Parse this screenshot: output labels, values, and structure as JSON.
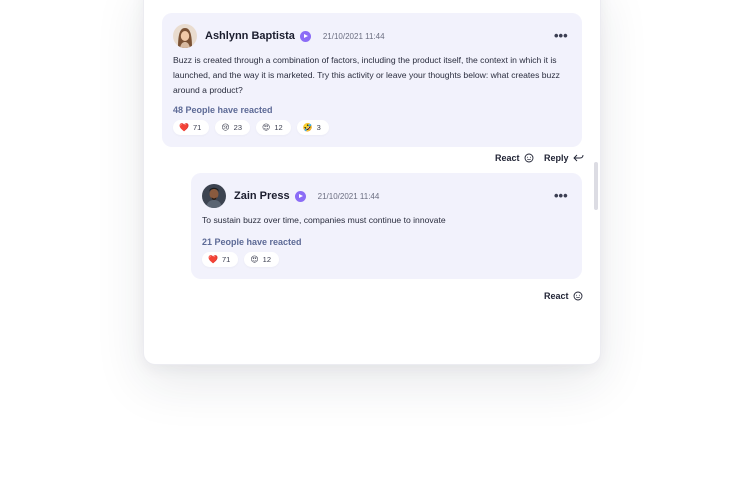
{
  "comments": [
    {
      "author": "Ashlynn Baptista",
      "timestamp": "21/10/2021 11:44",
      "text": "Buzz is created through a combination of factors, including the product itself, the context in which it is launched, and the way it is marketed. Try this activity or leave your thoughts below: what creates buzz around a product?",
      "reacted_label": "48 People have reacted",
      "reactions": [
        {
          "emoji": "❤️",
          "icon": "heart-icon",
          "count": "71"
        },
        {
          "emoji": "😢",
          "icon": "crying-face-icon",
          "count": "23"
        },
        {
          "emoji": "😍",
          "icon": "heart-eyes-icon",
          "count": "12"
        },
        {
          "emoji": "🤣",
          "icon": "rolling-laugh-icon",
          "count": "3"
        }
      ],
      "react_label": "React",
      "reply_label": "Reply"
    },
    {
      "author": "Zain Press",
      "timestamp": "21/10/2021 11:44",
      "text": "To sustain buzz over time, companies must continue to innovate",
      "reacted_label": "21 People have reacted",
      "reactions": [
        {
          "emoji": "❤️",
          "icon": "heart-icon",
          "count": "71"
        },
        {
          "emoji": "😍",
          "icon": "heart-eyes-icon",
          "count": "12"
        }
      ],
      "react_label": "React"
    }
  ],
  "more_glyph": "•••",
  "colors": {
    "comment_bg": "#f2f2fc",
    "verified_badge": "#8b6cf6",
    "reacted_text": "#5d6a96"
  }
}
